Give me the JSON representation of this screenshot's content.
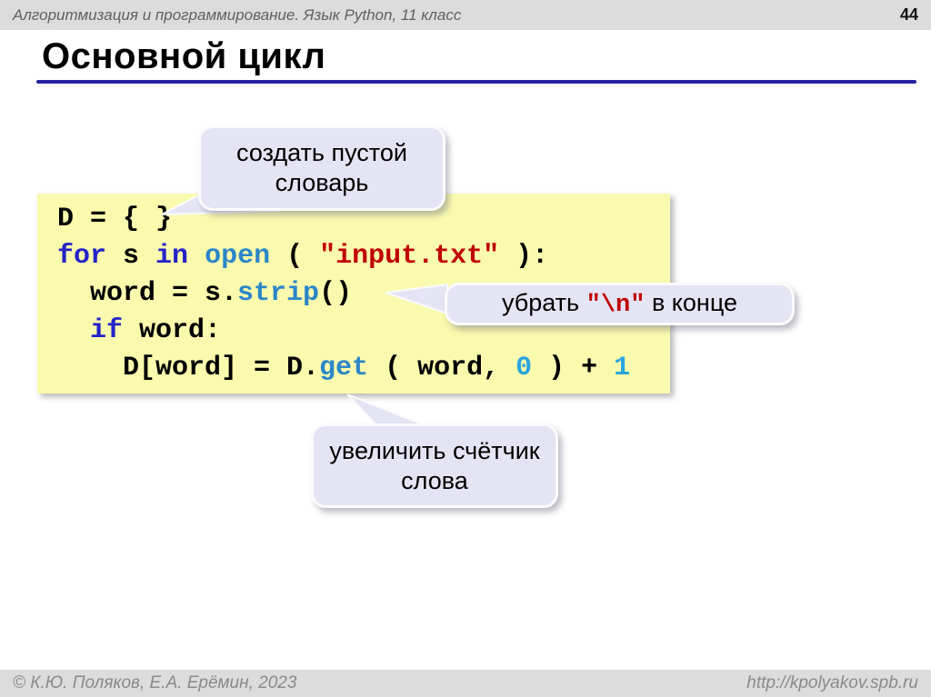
{
  "header": {
    "course_title": "Алгоритмизация и программирование. Язык Python, 11 класс",
    "page_number": "44"
  },
  "slide": {
    "title": "Основной цикл"
  },
  "code_block": {
    "language": "python",
    "lines": [
      {
        "segments": [
          {
            "text": "D = { }",
            "style": "plain"
          }
        ]
      },
      {
        "segments": [
          {
            "text": "for",
            "style": "keyword"
          },
          {
            "text": " s ",
            "style": "plain"
          },
          {
            "text": "in",
            "style": "keyword"
          },
          {
            "text": " ",
            "style": "plain"
          },
          {
            "text": "open",
            "style": "function"
          },
          {
            "text": " ( ",
            "style": "plain"
          },
          {
            "text": "\"input.txt\"",
            "style": "string"
          },
          {
            "text": " ):",
            "style": "plain"
          }
        ]
      },
      {
        "segments": [
          {
            "text": "  word = s.",
            "style": "plain"
          },
          {
            "text": "strip",
            "style": "function"
          },
          {
            "text": "()",
            "style": "plain"
          }
        ]
      },
      {
        "segments": [
          {
            "text": "  ",
            "style": "plain"
          },
          {
            "text": "if",
            "style": "keyword"
          },
          {
            "text": " word:",
            "style": "plain"
          }
        ]
      },
      {
        "segments": [
          {
            "text": "    D[word] = D.",
            "style": "plain"
          },
          {
            "text": "get",
            "style": "function"
          },
          {
            "text": " ( word, ",
            "style": "plain"
          },
          {
            "text": "0",
            "style": "number"
          },
          {
            "text": " ) + ",
            "style": "plain"
          },
          {
            "text": "1",
            "style": "number"
          }
        ]
      }
    ]
  },
  "callouts": [
    {
      "id": "create-empty-dict",
      "text": "создать пустой словарь"
    },
    {
      "id": "strip-newline",
      "parts": [
        {
          "text": "убрать ",
          "style": "plain"
        },
        {
          "text": "\"\\n\"",
          "style": "code-red"
        },
        {
          "text": " в конце",
          "style": "plain"
        }
      ]
    },
    {
      "id": "increment-word-counter",
      "text": "увеличить счётчик слова"
    }
  ],
  "footer": {
    "copyright": "© К.Ю. Поляков, Е.А. Ерёмин, 2023",
    "website": "http://kpolyakov.spb.ru"
  },
  "colors": {
    "accent_rule": "#23239e",
    "header_footer_bg": "#dcdcdc",
    "code_background": "#fafaae",
    "keyword_blue": "#2323c8",
    "function_teal": "#2b86c8",
    "number_cyan": "#2aa5dc",
    "string_red": "#c00000",
    "bubble_fill": "#e4e4f4"
  }
}
